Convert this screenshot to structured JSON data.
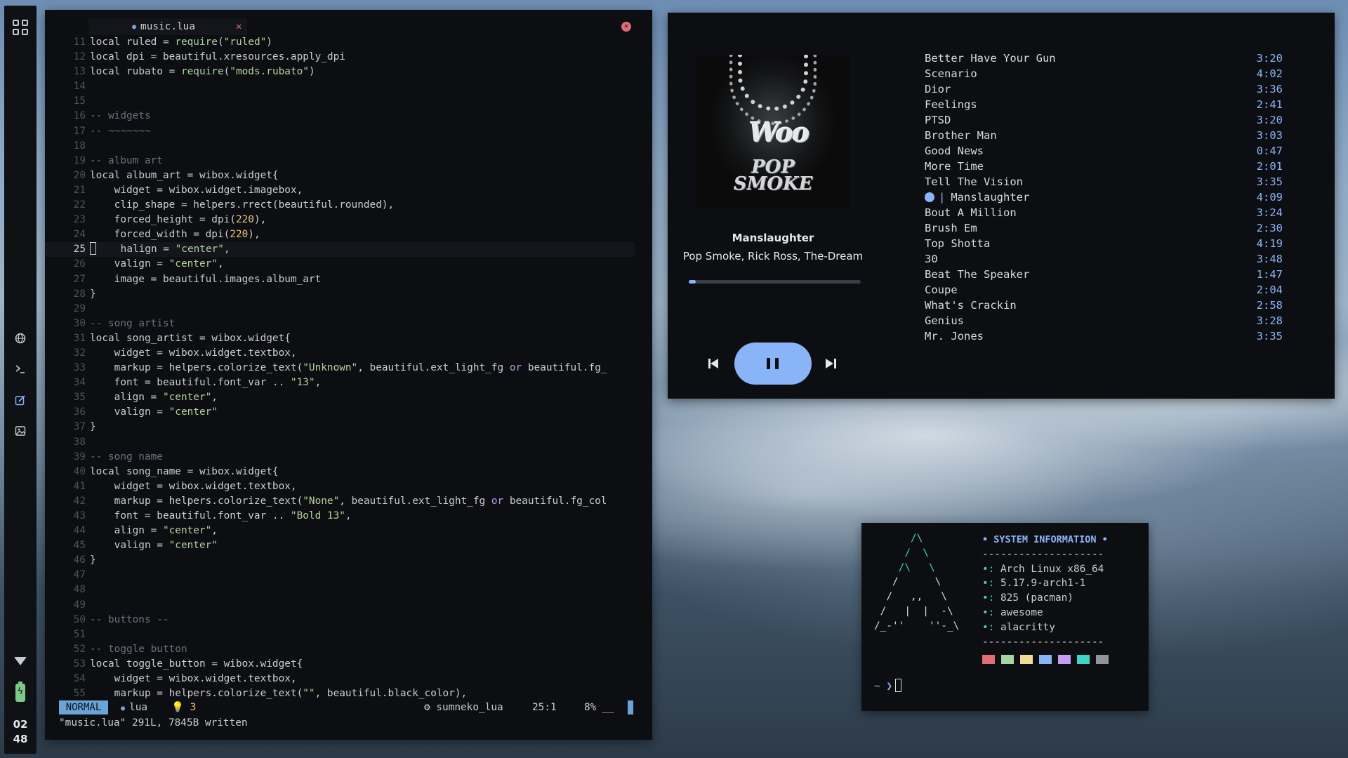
{
  "sidebar": {
    "clock_hour": "02",
    "clock_minute": "48",
    "icons": [
      "apps-grid-icon",
      "globe-icon",
      "terminal-icon",
      "edit-icon",
      "image-icon",
      "wifi-icon",
      "battery-icon"
    ]
  },
  "editor": {
    "tab_title": "music.lua",
    "tab_close": "✕",
    "lines": [
      {
        "n": "11",
        "t": "local ruled = require(\"ruled\")"
      },
      {
        "n": "12",
        "t": "local dpi = beautiful.xresources.apply_dpi"
      },
      {
        "n": "13",
        "t": "local rubato = require(\"mods.rubato\")"
      },
      {
        "n": "14",
        "t": ""
      },
      {
        "n": "15",
        "t": ""
      },
      {
        "n": "16",
        "t": "-- widgets"
      },
      {
        "n": "17",
        "t": "-- ~~~~~~~"
      },
      {
        "n": "18",
        "t": ""
      },
      {
        "n": "19",
        "t": "-- album art"
      },
      {
        "n": "20",
        "t": "local album_art = wibox.widget{"
      },
      {
        "n": "21",
        "t": "    widget = wibox.widget.imagebox,"
      },
      {
        "n": "22",
        "t": "    clip_shape = helpers.rrect(beautiful.rounded),"
      },
      {
        "n": "23",
        "t": "    forced_height = dpi(220),"
      },
      {
        "n": "24",
        "t": "    forced_width = dpi(220),"
      },
      {
        "n": "25",
        "t": "    halign = \"center\","
      },
      {
        "n": "26",
        "t": "    valign = \"center\","
      },
      {
        "n": "27",
        "t": "    image = beautiful.images.album_art"
      },
      {
        "n": "28",
        "t": "}"
      },
      {
        "n": "29",
        "t": ""
      },
      {
        "n": "30",
        "t": "-- song artist"
      },
      {
        "n": "31",
        "t": "local song_artist = wibox.widget{"
      },
      {
        "n": "32",
        "t": "    widget = wibox.widget.textbox,"
      },
      {
        "n": "33",
        "t": "    markup = helpers.colorize_text(\"Unknown\", beautiful.ext_light_fg or beautiful.fg_"
      },
      {
        "n": "34",
        "t": "    font = beautiful.font_var .. \"13\","
      },
      {
        "n": "35",
        "t": "    align = \"center\","
      },
      {
        "n": "36",
        "t": "    valign = \"center\""
      },
      {
        "n": "37",
        "t": "}"
      },
      {
        "n": "38",
        "t": ""
      },
      {
        "n": "39",
        "t": "-- song name"
      },
      {
        "n": "40",
        "t": "local song_name = wibox.widget{"
      },
      {
        "n": "41",
        "t": "    widget = wibox.widget.textbox,"
      },
      {
        "n": "42",
        "t": "    markup = helpers.colorize_text(\"None\", beautiful.ext_light_fg or beautiful.fg_col"
      },
      {
        "n": "43",
        "t": "    font = beautiful.font_var .. \"Bold 13\","
      },
      {
        "n": "44",
        "t": "    align = \"center\","
      },
      {
        "n": "45",
        "t": "    valign = \"center\""
      },
      {
        "n": "46",
        "t": "}"
      },
      {
        "n": "47",
        "t": ""
      },
      {
        "n": "48",
        "t": ""
      },
      {
        "n": "49",
        "t": ""
      },
      {
        "n": "50",
        "t": "-- buttons --"
      },
      {
        "n": "51",
        "t": ""
      },
      {
        "n": "52",
        "t": "-- toggle button"
      },
      {
        "n": "53",
        "t": "local toggle_button = wibox.widget{"
      },
      {
        "n": "54",
        "t": "    widget = wibox.widget.textbox,"
      },
      {
        "n": "55",
        "t": "    markup = helpers.colorize_text(\"\", beautiful.black_color),"
      }
    ],
    "current_line": "25",
    "status": {
      "mode": "NORMAL",
      "filetype": "lua",
      "warnings": "3",
      "lsp": "sumneko_lua",
      "position": "25:1",
      "percent": "8%",
      "underline": "__"
    },
    "message": "\"music.lua\" 291L, 7845B written"
  },
  "player": {
    "song_title": "Manslaughter",
    "song_artist": "Pop Smoke, Rick Ross, The-Dream",
    "progress": 0.04,
    "album_art_text": {
      "pendant": "Woo",
      "brand": "POP SMOKE"
    },
    "tracks": [
      {
        "title": "Better Have Your Gun",
        "duration": "3:20"
      },
      {
        "title": "Scenario",
        "duration": "4:02"
      },
      {
        "title": "Dior",
        "duration": "3:36"
      },
      {
        "title": "Feelings",
        "duration": "2:41"
      },
      {
        "title": "PTSD",
        "duration": "3:20"
      },
      {
        "title": "Brother Man",
        "duration": "3:03"
      },
      {
        "title": "Good News",
        "duration": "0:47"
      },
      {
        "title": "More Time",
        "duration": "2:01"
      },
      {
        "title": "Tell The Vision",
        "duration": "3:35"
      },
      {
        "title": "Manslaughter",
        "duration": "4:09",
        "playing": true
      },
      {
        "title": "Bout A Million",
        "duration": "3:24"
      },
      {
        "title": "Brush Em",
        "duration": "2:30"
      },
      {
        "title": "Top Shotta",
        "duration": "4:19"
      },
      {
        "title": "30",
        "duration": "3:48"
      },
      {
        "title": "Beat The Speaker",
        "duration": "1:47"
      },
      {
        "title": "Coupe",
        "duration": "2:04"
      },
      {
        "title": "What's Crackin",
        "duration": "2:58"
      },
      {
        "title": "Genius",
        "duration": "3:28"
      },
      {
        "title": "Mr. Jones",
        "duration": "3:35"
      }
    ]
  },
  "terminal": {
    "header": "• SYSTEM INFORMATION •",
    "divider": "--------------------",
    "info": [
      {
        "label": "•:",
        "value": "Arch Linux x86_64"
      },
      {
        "label": "•:",
        "value": "5.17.9-arch1-1"
      },
      {
        "label": "•:",
        "value": "825 (pacman)"
      },
      {
        "label": "•:",
        "value": "awesome"
      },
      {
        "label": "•:",
        "value": "alacritty"
      }
    ],
    "swatch_colors": [
      "#e06c75",
      "#a7d4a0",
      "#f5d998",
      "#8ab4f8",
      "#c49cf2",
      "#3dd6c4",
      "#8f939a"
    ],
    "prompt": "~ ❯"
  }
}
